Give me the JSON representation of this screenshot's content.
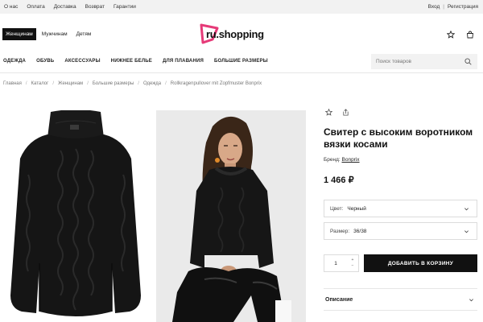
{
  "topbar": {
    "links": [
      "О нас",
      "Оплата",
      "Доставка",
      "Возврат",
      "Гарантии"
    ],
    "login": "Вход",
    "separator": "|",
    "register": "Регистрация"
  },
  "header": {
    "gender_tabs": [
      "Женщинам",
      "Мужчинам",
      "Детям"
    ],
    "active_gender": "Женщинам",
    "logo_text": "ru.shopping",
    "accent_color": "#e63a78",
    "icons": [
      "star-icon",
      "cart-icon"
    ]
  },
  "nav": {
    "categories": [
      "ОДЕЖДА",
      "ОБУВЬ",
      "АКСЕССУАРЫ",
      "НИЖНЕЕ БЕЛЬЕ",
      "ДЛЯ ПЛАВАНИЯ",
      "БОЛЬШИЕ РАЗМЕРЫ"
    ],
    "search_placeholder": "Поиск товаров"
  },
  "breadcrumb": [
    "Главная",
    "Каталог",
    "Женщинам",
    "Большие размеры",
    "Одежда",
    "Rollkragenpullover mit Zopfmuster Bonprix"
  ],
  "product": {
    "title": "Свитер с высоким воротником вязки косами",
    "brand_label": "Бренд:",
    "brand": "Bonprix",
    "price": "1 466 ₽",
    "color_label": "Цвет:",
    "color_value": "Черный",
    "size_label": "Размер:",
    "size_value": "36/38",
    "quantity": "1",
    "add_to_cart": "ДОБАВИТЬ В КОРЗИНУ",
    "description_label": "Описание"
  }
}
